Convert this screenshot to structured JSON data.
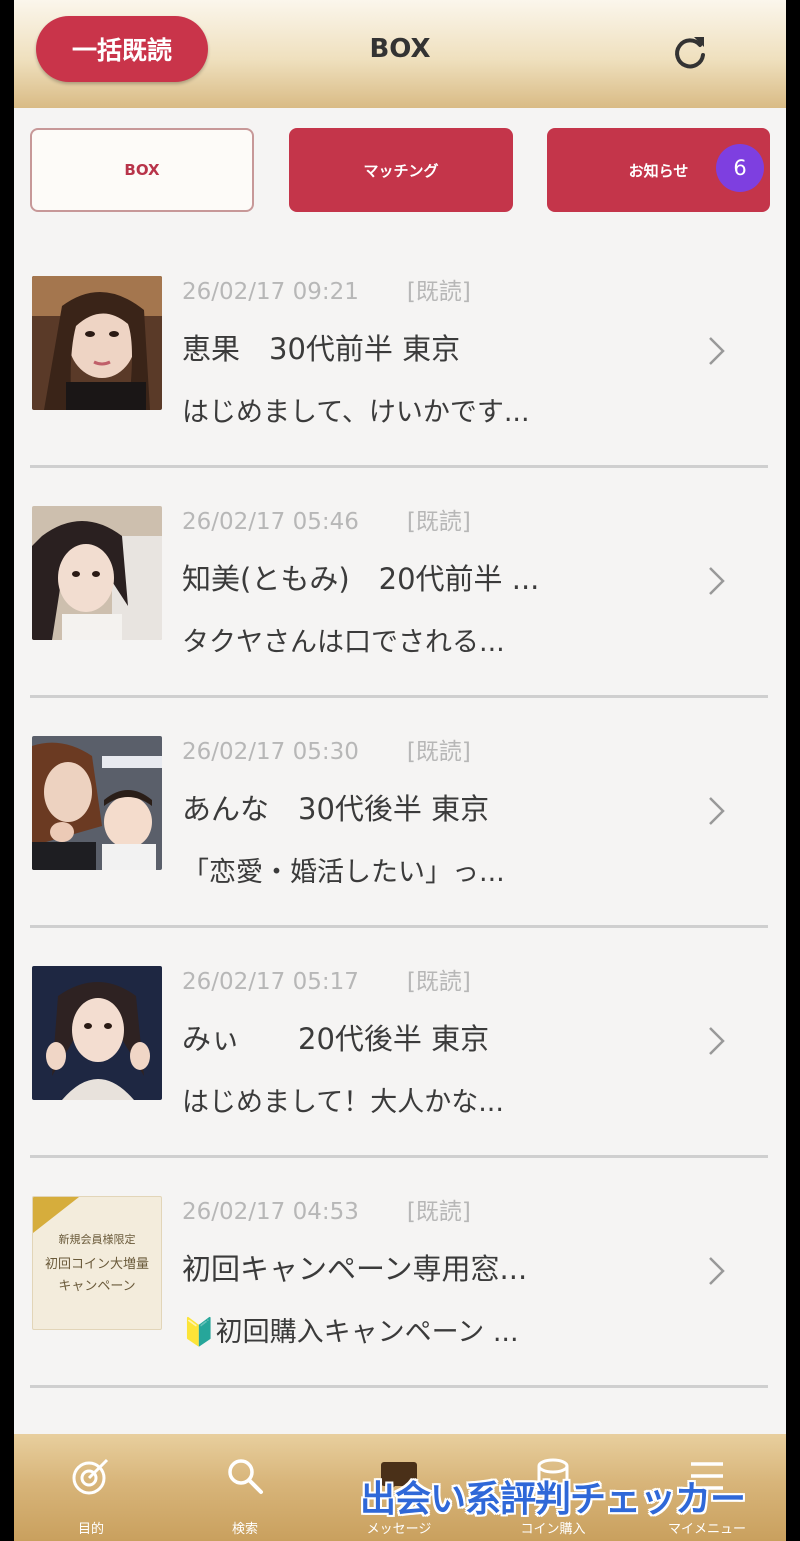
{
  "header": {
    "mark_all_read_label": "一括既読",
    "title": "BOX",
    "refresh_icon": "refresh-icon"
  },
  "tabs": [
    {
      "label": "BOX",
      "active": true
    },
    {
      "label": "マッチング",
      "active": false
    },
    {
      "label": "お知らせ",
      "active": false,
      "badge": "6"
    }
  ],
  "messages": [
    {
      "timestamp": "26/02/17 09:21",
      "status": "[既読]",
      "name": "恵果　30代前半 東京",
      "preview": "はじめまして、けいかです..."
    },
    {
      "timestamp": "26/02/17 05:46",
      "status": "[既読]",
      "name": "知美(ともみ)　20代前半 ...",
      "preview": "タクヤさんは口でされる..."
    },
    {
      "timestamp": "26/02/17 05:30",
      "status": "[既読]",
      "name": "あんな　30代後半 東京",
      "preview": "「恋愛・婚活したい」っ..."
    },
    {
      "timestamp": "26/02/17 05:17",
      "status": "[既読]",
      "name": "みぃ　　20代後半 東京",
      "preview": "はじめまして！大人かな..."
    },
    {
      "timestamp": "26/02/17 04:53",
      "status": "[既読]",
      "name": "初回キャンペーン専用窓...",
      "preview": "🔰初回購入キャンペーン ..."
    }
  ],
  "campaign_thumbnail": {
    "line1": "新規会員様限定",
    "line2": "初回コイン大増量",
    "line3": "キャンペーン"
  },
  "bottom_nav": [
    {
      "label": "目的",
      "icon": "target-icon"
    },
    {
      "label": "検索",
      "icon": "search-icon"
    },
    {
      "label": "メッセージ",
      "icon": "message-icon"
    },
    {
      "label": "コイン購入",
      "icon": "coin-icon"
    },
    {
      "label": "マイメニュー",
      "icon": "menu-icon"
    }
  ],
  "watermark": "出会い系評判チェッカー",
  "colors": {
    "accent": "#c4354a",
    "badge": "#7e3fe0",
    "header_gold": "#d9bb85"
  }
}
